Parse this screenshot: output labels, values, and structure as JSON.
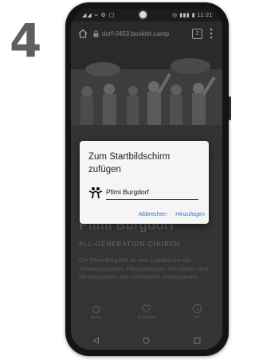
{
  "step": {
    "number": "4"
  },
  "status_bar": {
    "left": "◢◢ ≈ ⚙ ▢",
    "right": "◎ ▮▮▮ ▮ 11:21"
  },
  "browser": {
    "url": "dorf-0453.booklet.camp",
    "tab_count": "2"
  },
  "site": {
    "title": "Pfimi Burgdorf",
    "subtitle": "ALL-GENERATION-CHURCH",
    "text": "Die Pfimi Burgdorf ist eine Lokalkirche der Schweizerischen Pfingstmission. Wir lieben Gott, die Menschen und himmlische Dimensionen.",
    "nav": [
      {
        "label": "Home",
        "icon": "home-icon"
      },
      {
        "label": "Angebote",
        "icon": "heart-icon"
      },
      {
        "label": "Info",
        "icon": "info-icon"
      }
    ]
  },
  "dialog": {
    "title": "Zum Startbildschirm zufügen",
    "input_value": "Pfimi Burgdorf",
    "cancel_label": "Abbrechen",
    "add_label": "Hinzufügen"
  },
  "colors": {
    "accent": "#2a74d6",
    "step_number": "#5f5f5f",
    "phone_frame": "#141414"
  }
}
